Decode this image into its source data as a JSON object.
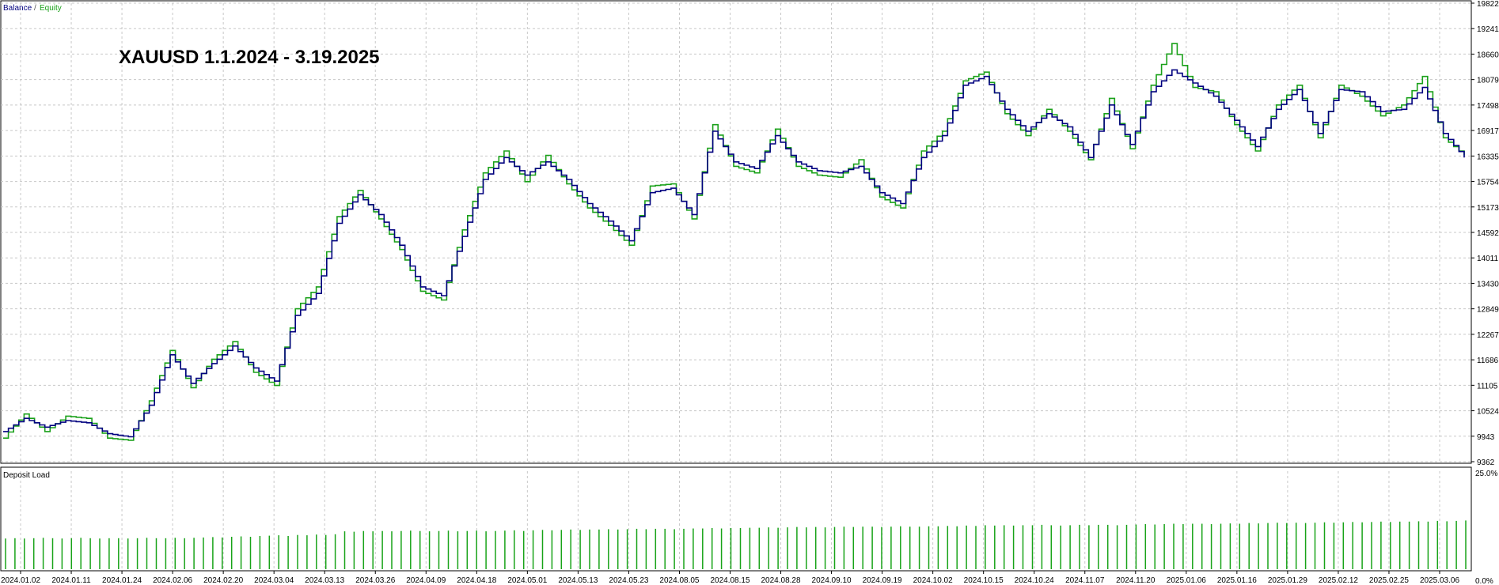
{
  "app": {
    "title": "XAUUSD 1.1.2024 - 3.19.2025"
  },
  "colors": {
    "balance": "#00007f",
    "equity": "#1aa11a",
    "grid": "#c8c8c8",
    "axis": "#000000",
    "deposit": "#18a318"
  },
  "chart_data": [
    {
      "type": "line",
      "title": "XAUUSD 1.1.2024 - 3.19.2025",
      "legend": {
        "placement": "top-left",
        "items": [
          {
            "label": "Balance",
            "color": "#00007f"
          },
          {
            "label": "/",
            "color": "#555555"
          },
          {
            "label": "Equity",
            "color": "#1aa11a"
          }
        ]
      },
      "grid": true,
      "ylim": [
        9362,
        19822
      ],
      "y_ticks": [
        "19822",
        "19241",
        "18660",
        "18079",
        "17498",
        "16917",
        "16335",
        "15754",
        "15173",
        "14592",
        "14011",
        "13430",
        "12849",
        "12267",
        "11686",
        "11105",
        "10524",
        "9943",
        "9362"
      ],
      "x_ticks": [
        "2024.01.02",
        "2024.01.11",
        "2024.01.24",
        "2024.02.06",
        "2024.02.20",
        "2024.03.04",
        "2024.03.13",
        "2024.03.26",
        "2024.04.09",
        "2024.04.18",
        "2024.05.01",
        "2024.05.13",
        "2024.05.23",
        "2024.08.05",
        "2024.08.15",
        "2024.08.28",
        "2024.09.10",
        "2024.09.19",
        "2024.10.02",
        "2024.10.15",
        "2024.10.24",
        "2024.11.07",
        "2024.11.20",
        "2025.01.06",
        "2025.01.16",
        "2025.01.29",
        "2025.02.12",
        "2025.02.25",
        "2025.03.06"
      ],
      "series": [
        {
          "name": "Balance",
          "color": "#00007f",
          "values": [
            10050,
            10350,
            10150,
            10300,
            10250,
            10000,
            9930,
            10650,
            11800,
            11150,
            11600,
            12000,
            11500,
            11200,
            12700,
            13200,
            14800,
            15450,
            15000,
            14300,
            13350,
            13150,
            14500,
            15800,
            16300,
            15900,
            16200,
            15800,
            15250,
            14850,
            14400,
            15500,
            15600,
            15000,
            16900,
            16200,
            16050,
            16800,
            16200,
            16000,
            15950,
            16100,
            15500,
            15250,
            16300,
            16800,
            17950,
            18150,
            17400,
            16900,
            17300,
            17000,
            16300,
            17500,
            16600,
            17800,
            18300,
            18000,
            17700,
            17150,
            16550,
            17400,
            17850,
            16850,
            17850,
            17800,
            17350,
            17400,
            17900,
            16850,
            16300
          ]
        },
        {
          "name": "Equity",
          "color": "#1aa11a",
          "values": [
            9900,
            10450,
            10050,
            10400,
            10350,
            9900,
            9850,
            10750,
            11900,
            11050,
            11700,
            12100,
            11400,
            11100,
            12850,
            13350,
            14950,
            15550,
            14900,
            14200,
            13250,
            13050,
            14650,
            15950,
            16450,
            15750,
            16350,
            15700,
            15150,
            14750,
            14300,
            15650,
            15700,
            14900,
            17050,
            16100,
            15950,
            16950,
            16100,
            15900,
            15850,
            16250,
            15400,
            15150,
            16450,
            16900,
            18050,
            18250,
            17300,
            16800,
            17400,
            16900,
            16250,
            17650,
            16500,
            17950,
            18900,
            17900,
            17800,
            17050,
            16450,
            17500,
            17950,
            16750,
            17950,
            17700,
            17250,
            17500,
            18150,
            16750,
            16350
          ]
        }
      ]
    },
    {
      "type": "bar",
      "title": "Deposit Load",
      "ylim": [
        0,
        25
      ],
      "y_ticks": [
        "25.0%",
        "0.0%"
      ],
      "series": [
        {
          "name": "Deposit Load",
          "color": "#18a318",
          "values": [
            8.5,
            8.6,
            8.5,
            8.6,
            8.7,
            8.6,
            8.5,
            8.6,
            8.7,
            8.6,
            8.5,
            8.6,
            8.6,
            8.5,
            8.6,
            8.7,
            8.6,
            8.6,
            8.7,
            8.6,
            8.7,
            8.8,
            8.9,
            8.8,
            9.0,
            9.1,
            9.0,
            9.2,
            9.3,
            9.4,
            9.2,
            9.5,
            9.4,
            9.6,
            9.5,
            9.7,
            10.5,
            10.4,
            10.6,
            10.5,
            10.6,
            10.5,
            10.6,
            10.7,
            10.6,
            10.5,
            10.6,
            10.7,
            10.5,
            10.6,
            10.7,
            10.5,
            10.6,
            10.7,
            10.8,
            10.6,
            10.8,
            10.9,
            10.8,
            10.9,
            11.0,
            10.9,
            11.0,
            11.0,
            11.1,
            11.0,
            11.1,
            11.2,
            11.1,
            11.2,
            11.2,
            11.1,
            11.2,
            11.3,
            11.3,
            11.4,
            11.3,
            11.4,
            11.4,
            11.5,
            11.5,
            11.6,
            11.5,
            11.6,
            11.7,
            11.6,
            11.7,
            11.6,
            11.7,
            11.8,
            11.7,
            11.8,
            11.8,
            11.7,
            11.8,
            11.9,
            11.8,
            11.8,
            11.9,
            11.9,
            12.0,
            11.9,
            12.1,
            12.0,
            12.2,
            12.1,
            12.2,
            12.1,
            12.2,
            12.2,
            12.3,
            12.2,
            12.1,
            12.2,
            12.3,
            12.2,
            12.3,
            12.3,
            12.2,
            12.3,
            12.4,
            12.5,
            12.4,
            12.5,
            12.6,
            12.5,
            12.6,
            12.6,
            12.5,
            12.6,
            12.7,
            12.6,
            12.8,
            12.7,
            12.8,
            12.9,
            12.8,
            12.9,
            12.8,
            12.9,
            13.0,
            12.9,
            13.0,
            13.1,
            13.0,
            13.1,
            13.2,
            13.1,
            13.2,
            13.2,
            13.3,
            13.2,
            13.4,
            13.3,
            13.4,
            13.5
          ]
        }
      ]
    }
  ]
}
